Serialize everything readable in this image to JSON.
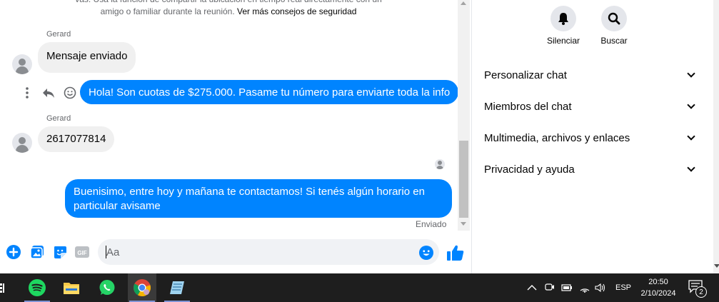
{
  "chat": {
    "notice_line1": "vas. Usa la función de compartir la ubicación en tiempo real directamente con un",
    "notice_line2_prefix": "amigo o familiar durante la reunión. ",
    "notice_link": "Ver más consejos de seguridad",
    "messages": [
      {
        "sender": "Gerard",
        "text": "Mensaje enviado",
        "direction": "in"
      },
      {
        "text": "Hola! Son cuotas de $275.000. Pasame tu número para enviarte toda la info",
        "direction": "out"
      },
      {
        "sender": "Gerard",
        "text": "2617077814",
        "direction": "in"
      },
      {
        "text_line1": "Buenisimo, entre hoy y mañana te contactamos! Si tenés algún horario en",
        "text_line2": "particular avisame",
        "direction": "out"
      }
    ],
    "status": "Enviado",
    "composer_placeholder": "Aa",
    "accent_color": "#0084ff"
  },
  "panel": {
    "actions": [
      {
        "label": "Silenciar",
        "icon": "bell-icon"
      },
      {
        "label": "Buscar",
        "icon": "search-icon"
      }
    ],
    "sections": [
      "Personalizar chat",
      "Miembros del chat",
      "Multimedia, archivos y enlaces",
      "Privacidad y ayuda"
    ]
  },
  "taskbar": {
    "apps": [
      "spotify-icon",
      "file-explorer-icon",
      "whatsapp-icon",
      "chrome-icon",
      "notepad-icon"
    ],
    "language": "ESP",
    "time": "20:50",
    "date": "2/10/2024",
    "notification_count": "2"
  }
}
